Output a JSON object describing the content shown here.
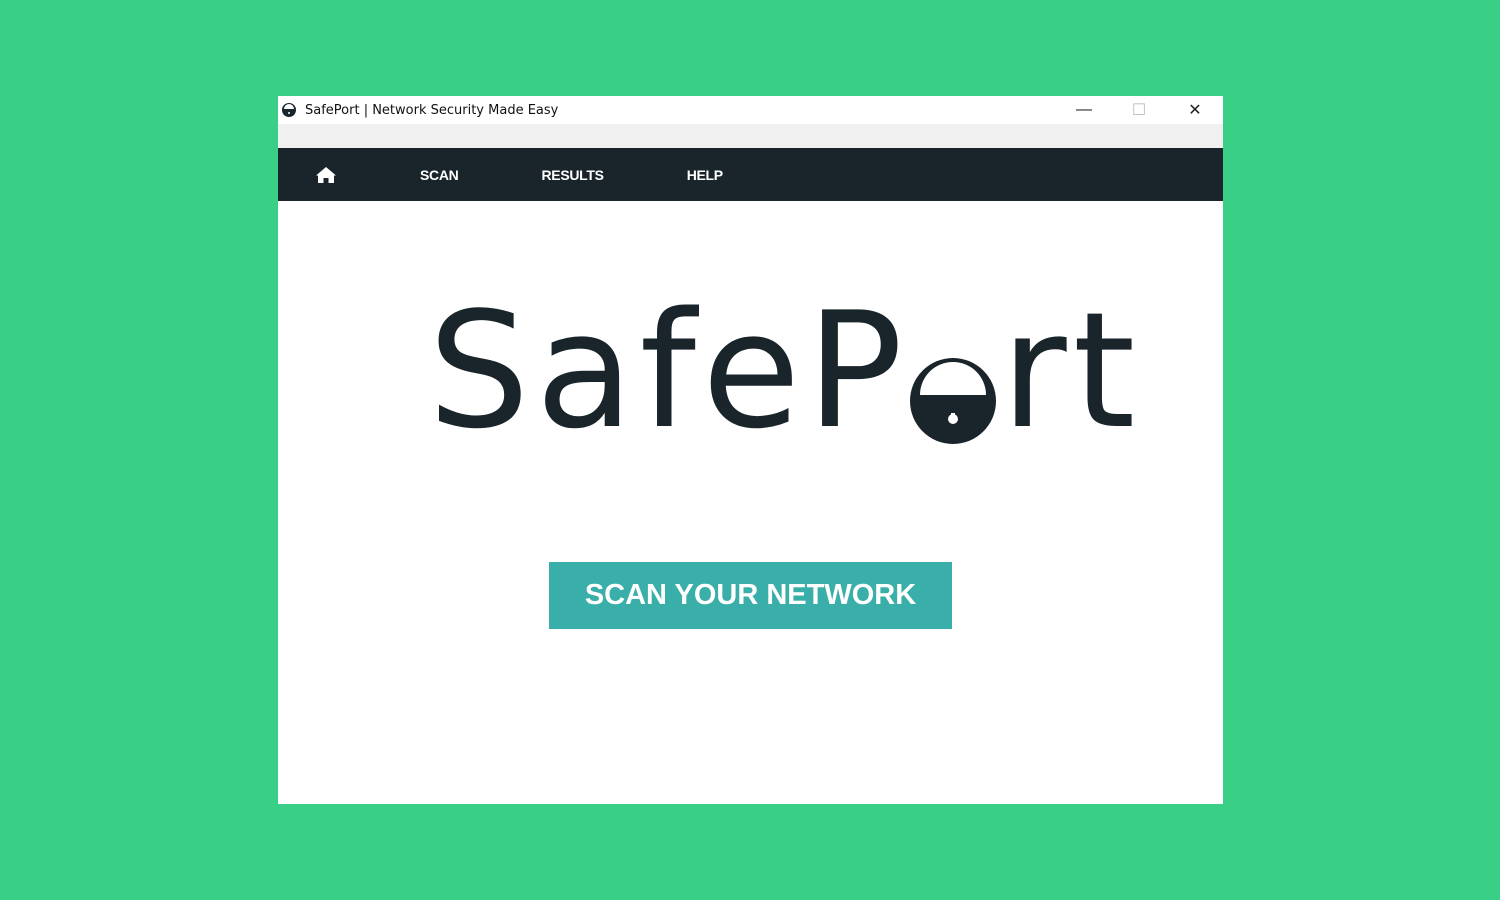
{
  "window": {
    "title": "SafePort | Network Security Made Easy",
    "minimize": "—",
    "maximize": "☐",
    "close": "✕"
  },
  "nav": {
    "home_icon": "home-icon",
    "items": [
      {
        "label": "SCAN"
      },
      {
        "label": "RESULTS"
      },
      {
        "label": "HELP"
      }
    ]
  },
  "logo": {
    "text": "SafePort",
    "part1": "SafeP",
    "part2": "rt"
  },
  "main": {
    "scan_button": "SCAN YOUR NETWORK"
  },
  "colors": {
    "background": "#3acf87",
    "nav": "#1a252b",
    "accent": "#3aafa9"
  }
}
